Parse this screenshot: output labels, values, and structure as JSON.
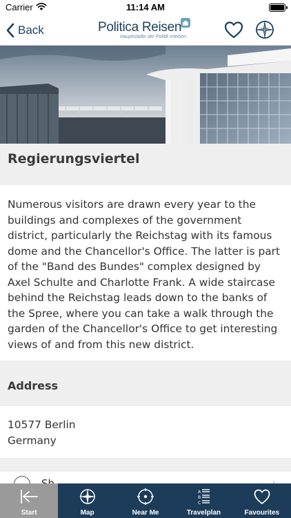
{
  "status": {
    "carrier": "Carrier",
    "time": "11:14 AM"
  },
  "nav": {
    "back_label": "Back",
    "brand": "Politica Reisen",
    "tagline": "Hauptstädte der Politik erleben."
  },
  "place": {
    "title": "Regierungsviertel",
    "description": "Numerous visitors are drawn every year to the buildings and complexes of the government district, particularly the Reichstag with its famous dome and the Chancellor's Office. The latter is part of the \"Band des Bundes\" complex designed by Axel Schulte and Charlotte Frank. A wide staircase behind the Reichstag leads down to the banks of the Spree, where you can take a walk through the garden of the Chancellor's Office to get interesting views of and from this new district."
  },
  "address": {
    "heading": "Address",
    "line1": "10577 Berlin",
    "line2": "Germany"
  },
  "share": {
    "label": "Sh"
  },
  "tabs": [
    {
      "label": "Start",
      "icon": "start-icon"
    },
    {
      "label": "Map",
      "icon": "compass-icon"
    },
    {
      "label": "Near Me",
      "icon": "crosshair-icon"
    },
    {
      "label": "Travelplan",
      "icon": "travelplan-icon"
    },
    {
      "label": "Favourites",
      "icon": "heart-icon"
    }
  ],
  "colors": {
    "brand": "#1b3f5e",
    "tabbar": "#1c3c5a",
    "active_tab": "#9a9a9a"
  }
}
